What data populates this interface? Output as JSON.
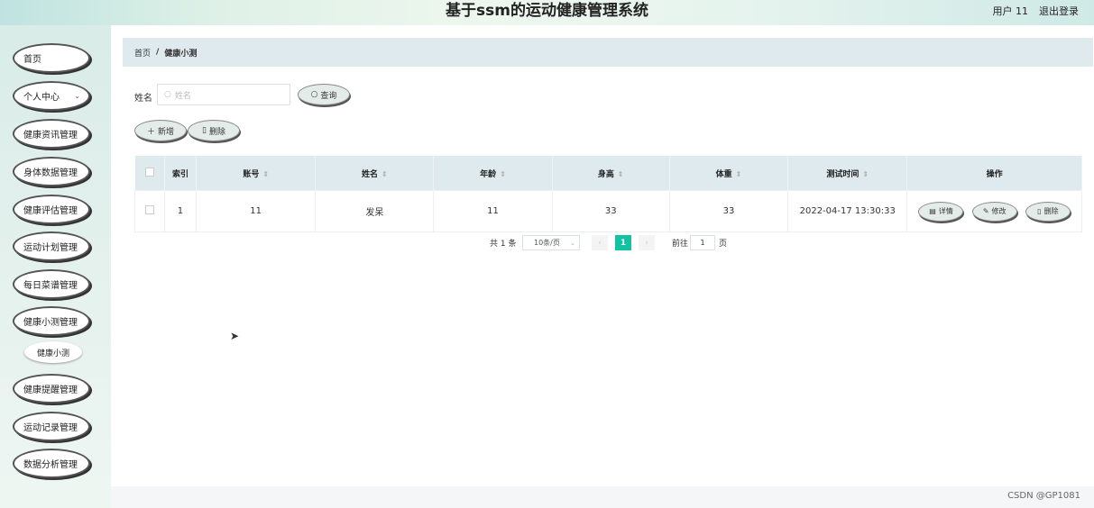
{
  "header": {
    "title": "基于ssm的运动健康管理系统",
    "user": "用户 11",
    "logout": "退出登录"
  },
  "sidebar": {
    "items": [
      {
        "label": "首页"
      },
      {
        "label": "个人中心",
        "icon": "chevron-down-icon"
      },
      {
        "label": "健康资讯管理"
      },
      {
        "label": "身体数据管理"
      },
      {
        "label": "健康评估管理"
      },
      {
        "label": "运动计划管理"
      },
      {
        "label": "每日菜谱管理"
      },
      {
        "label": "健康小测管理"
      },
      {
        "label": "健康提醒管理"
      },
      {
        "label": "运动记录管理"
      },
      {
        "label": "数据分析管理"
      }
    ],
    "submenu": {
      "label": "健康小测"
    }
  },
  "breadcrumb": {
    "home": "首页",
    "separator": "/",
    "current": "健康小测"
  },
  "search": {
    "label": "姓名",
    "placeholder": "姓名",
    "button": "查询",
    "icon": "search-icon"
  },
  "actions": {
    "add": "新增",
    "delete": "删除"
  },
  "table": {
    "columns": [
      "索引",
      "账号",
      "姓名",
      "年龄",
      "身高",
      "体重",
      "测试时间",
      "操作"
    ],
    "rows": [
      {
        "index": "1",
        "account": "11",
        "name": "发呆",
        "age": "11",
        "height": "33",
        "weight": "33",
        "time": "2022-04-17 13:30:33"
      }
    ],
    "row_actions": {
      "detail": "详情",
      "edit": "修改",
      "delete": "删除"
    }
  },
  "pagination": {
    "total": "共 1 条",
    "page_size": "10条/页",
    "prev": "‹",
    "current": "1",
    "next": "›",
    "goto_label": "前往",
    "goto_value": "1",
    "goto_suffix": "页"
  },
  "watermark": "CSDN @GP1081",
  "colors": {
    "accent": "#13c2a0",
    "header_bg": "#dfeaee"
  }
}
